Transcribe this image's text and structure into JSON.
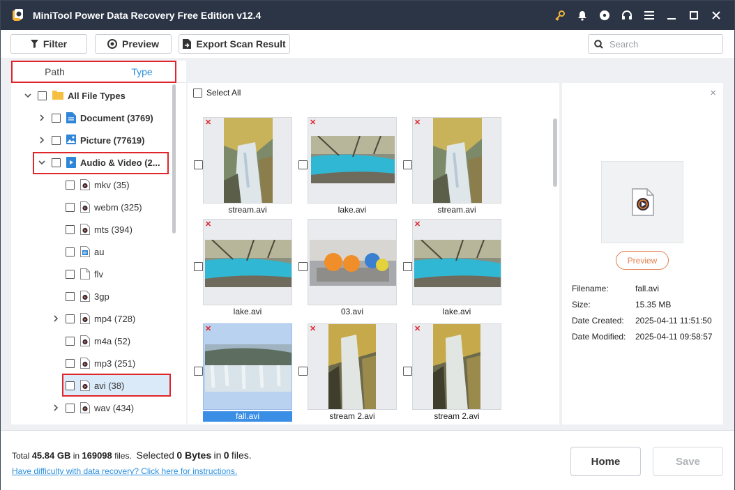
{
  "window": {
    "title": "MiniTool Power Data Recovery Free Edition v12.4",
    "icons": [
      "key-icon",
      "bell-icon",
      "disc-icon",
      "headset-icon",
      "menu-icon",
      "minimize-icon",
      "maximize-icon",
      "close-icon"
    ]
  },
  "toolbar": {
    "filter_label": "Filter",
    "preview_label": "Preview",
    "export_label": "Export Scan Result",
    "search_placeholder": "Search"
  },
  "tabs": [
    {
      "label": "Path",
      "active": false
    },
    {
      "label": "Type",
      "active": true
    }
  ],
  "tree": {
    "root": {
      "label": "All File Types",
      "expanded": true
    },
    "document": {
      "label": "Document (3769)",
      "expanded": false
    },
    "picture": {
      "label": "Picture (77619)",
      "expanded": false
    },
    "audio_video": {
      "label": "Audio & Video (2...",
      "expanded": true
    },
    "children": [
      {
        "label": "mkv (35)",
        "expandable": false
      },
      {
        "label": "webm (325)",
        "expandable": false
      },
      {
        "label": "mts (394)",
        "expandable": false
      },
      {
        "label": "au",
        "expandable": false
      },
      {
        "label": "flv",
        "expandable": false
      },
      {
        "label": "3gp",
        "expandable": false
      },
      {
        "label": "mp4 (728)",
        "expandable": true
      },
      {
        "label": "m4a (52)",
        "expandable": false
      },
      {
        "label": "mp3 (251)",
        "expandable": false
      },
      {
        "label": "avi (38)",
        "expandable": false,
        "selected": true
      },
      {
        "label": "wav (434)",
        "expandable": true
      }
    ]
  },
  "grid": {
    "select_all_label": "Select All",
    "files": [
      {
        "name": "stream.avi",
        "deleted": true,
        "selected": false
      },
      {
        "name": "lake.avi",
        "deleted": true,
        "selected": false
      },
      {
        "name": "stream.avi",
        "deleted": true,
        "selected": false
      },
      {
        "name": "lake.avi",
        "deleted": true,
        "selected": false
      },
      {
        "name": "03.avi",
        "deleted": false,
        "selected": false
      },
      {
        "name": "lake.avi",
        "deleted": true,
        "selected": false
      },
      {
        "name": "fall.avi",
        "deleted": true,
        "selected": true
      },
      {
        "name": "stream 2.avi",
        "deleted": true,
        "selected": false
      },
      {
        "name": "stream 2.avi",
        "deleted": true,
        "selected": false
      }
    ]
  },
  "detail": {
    "close_glyph": "×",
    "preview_label": "Preview",
    "filename_label": "Filename:",
    "filename": "fall.avi",
    "size_label": "Size:",
    "size": "15.35 MB",
    "created_label": "Date Created:",
    "created": "2025-04-11 11:51:50",
    "modified_label": "Date Modified:",
    "modified": "2025-04-11 09:58:57"
  },
  "footer": {
    "total_prefix": "Total",
    "total_size": "45.84 GB",
    "in_word": "in",
    "total_files": "169098",
    "files_word": "files.",
    "selected_prefix": "Selected",
    "selected_size": "0 Bytes",
    "selected_files": "0",
    "help_link": "Have difficulty with data recovery? Click here for instructions.",
    "home_label": "Home",
    "save_label": "Save"
  },
  "colors": {
    "titlebar": "#2b3545",
    "accent_blue": "#2b8fde",
    "highlight_red": "#e0252b",
    "preview_orange": "#e0814f",
    "selected_tile": "#b8d2f0"
  }
}
